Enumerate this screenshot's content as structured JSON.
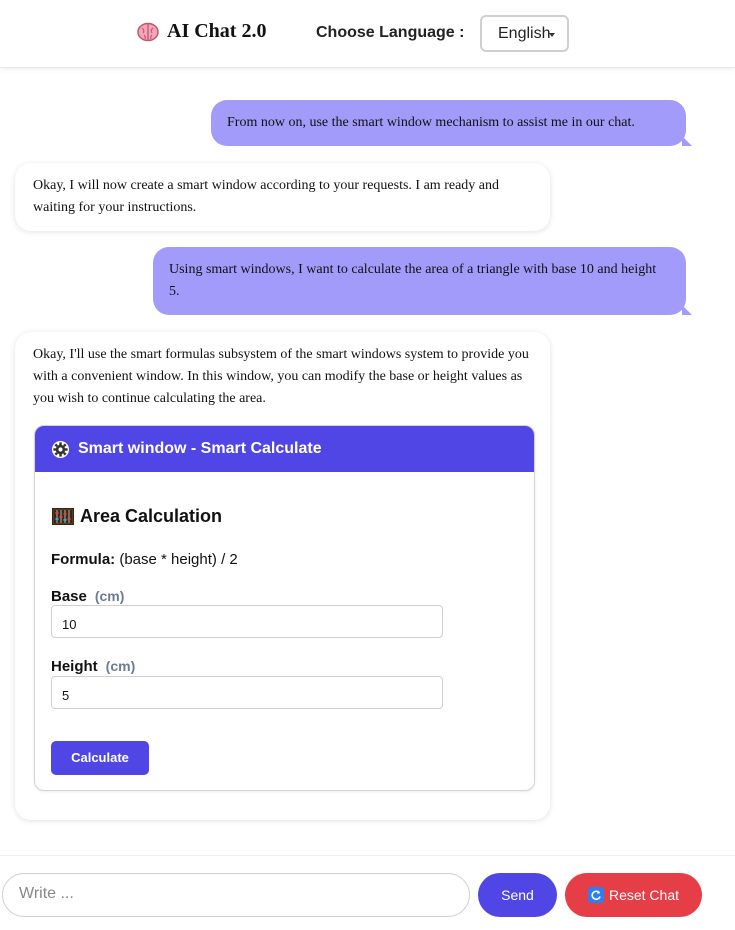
{
  "header": {
    "title": "AI Chat 2.0",
    "language_label": "Choose Language :",
    "language_selected": "English"
  },
  "messages": [
    {
      "role": "user",
      "text": "From now on, use the smart window mechanism to assist me in our chat."
    },
    {
      "role": "assistant",
      "text": "Okay, I will now create a smart window according to your requests. I am ready and waiting for your instructions."
    },
    {
      "role": "user",
      "text": "Using smart windows, I want to calculate the area of a triangle with base 10 and height 5."
    },
    {
      "role": "assistant",
      "text": "Okay, I'll use the smart formulas subsystem of the smart windows system to provide you with a convenient window. In this window, you can modify the base or height values as you wish to continue calculating the area."
    }
  ],
  "smart_window": {
    "title": "Smart window - Smart Calculate",
    "section_title": "Area Calculation",
    "formula_label": "Formula:",
    "formula_value": "(base * height) / 2",
    "base_label": "Base",
    "base_unit": "(cm)",
    "base_value": "10",
    "height_label": "Height",
    "height_unit": "(cm)",
    "height_value": "5",
    "calculate_label": "Calculate"
  },
  "footer": {
    "input_placeholder": "Write ...",
    "send_label": "Send",
    "reset_label": "Reset Chat"
  },
  "colors": {
    "accent": "#4f46e5",
    "user_bubble": "#a29bfa",
    "reset": "#e53e47"
  },
  "icons": {
    "brand": "brain-icon",
    "smart_window": "gear-icon",
    "section": "abacus-icon",
    "reset": "refresh-icon"
  }
}
